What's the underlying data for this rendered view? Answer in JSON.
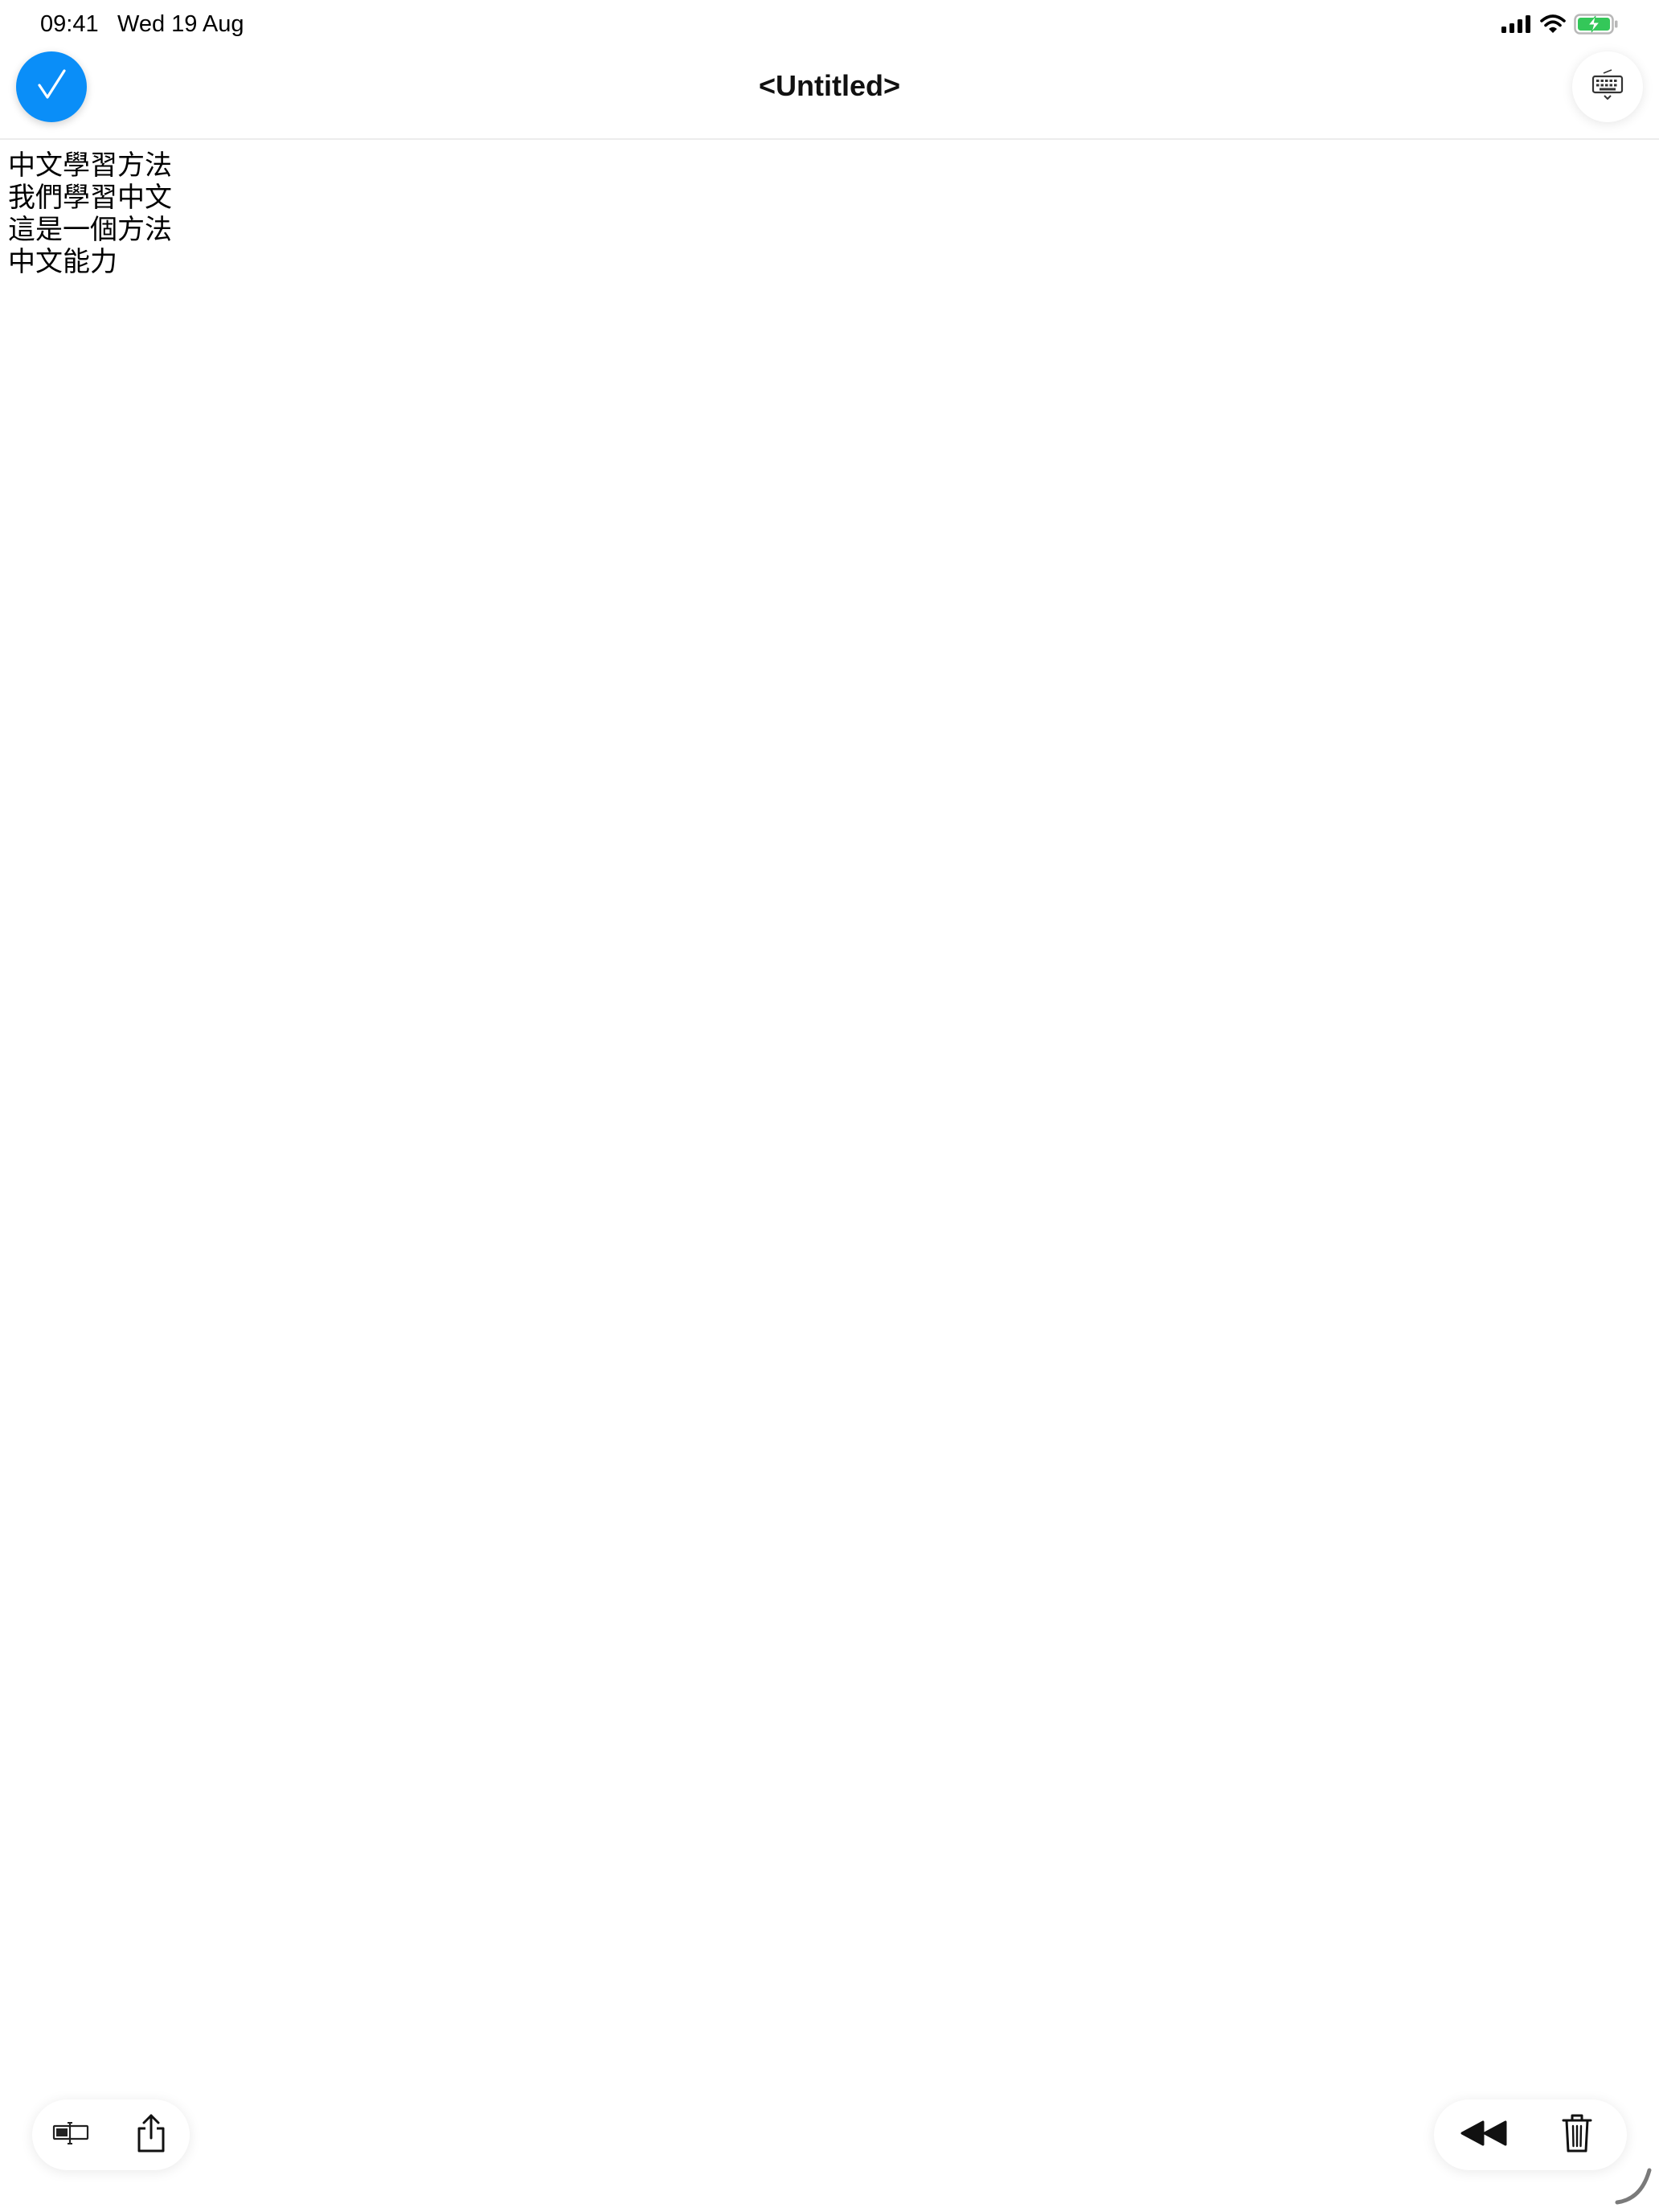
{
  "status_bar": {
    "time": "09:41",
    "date": "Wed 19 Aug",
    "icons": [
      "cellular-signal-icon",
      "wifi-icon",
      "battery-charging-icon"
    ],
    "battery_color": "#34c759"
  },
  "header": {
    "title": "<Untitled>",
    "done_icon": "checkmark-icon",
    "accent_color": "#0a8ef8",
    "keyboard_icon": "keyboard-dismiss-icon"
  },
  "document": {
    "lines": [
      "中文學習方法",
      "我們學習中文",
      "這是一個方法",
      "中文能力"
    ]
  },
  "bottom_toolbar": {
    "left": [
      "input-mode-icon",
      "share-icon"
    ],
    "right": [
      "rewind-icon",
      "trash-icon"
    ]
  }
}
